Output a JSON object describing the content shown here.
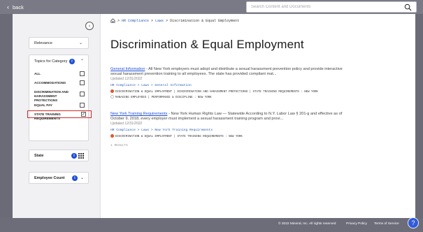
{
  "topbar": {
    "back_label": "back",
    "search_placeholder": "Search Content and Documents"
  },
  "sidebar": {
    "relevance_label": "Relevance",
    "topics_label": "Topics for Category",
    "topics": [
      {
        "label": "ALL",
        "checked": false
      },
      {
        "label": "ACCOMMODATIONS",
        "checked": false
      },
      {
        "label": "DISCRIMINATION AND HARASSMENT PROTECTIONS",
        "checked": false
      },
      {
        "label": "EQUAL PAY",
        "checked": false
      },
      {
        "label": "STATE TRAINING REQUIREMENTS",
        "checked": true
      }
    ],
    "state_label": "State",
    "employee_count_label": "Employee Count"
  },
  "breadcrumb": {
    "items": [
      "HR Compliance",
      "Laws",
      "Discrimination & Equal Employment"
    ]
  },
  "page_title": "Discrimination & Equal Employment",
  "results": [
    {
      "title": "General Information",
      "snippet": " - All New York employers must adopt and distribute a sexual harassment prevention policy and provide interactive sexual harassment prevention training to all employees. The state has provided compliant mat...",
      "date": "Updated 12/31/2022",
      "path": "HR Compliance > Laws > General Information",
      "tags_line1": "DISCRIMINATION & EQUAL EMPLOYMENT | DISCRIMINATION AND HARASSMENT PROTECTIONS | STATE TRAINING REQUIREMENTS : NEW YORK",
      "tags_line2": "MANAGING EMPLOYEES | PERFORMANCE & DISCIPLINE : NEW YORK"
    },
    {
      "title": "New York Training Requirements",
      "snippet": " - New York Human Rights Law — Statewide According to N.Y. Labor Law § 201-g and effective as of October 9, 2018, every employer must implement a sexual harassment training program and provi...",
      "date": "Updated 12/31/2022",
      "path": "HR Compliance > Laws > New York Training Requirements",
      "tags_line1": "DISCRIMINATION & EQUAL EMPLOYMENT | STATE TRAINING REQUIREMENTS : NEW YORK"
    }
  ],
  "more_results": "1 RESULTS",
  "footer": {
    "copyright": "© 2022 Mineral, Inc. All rights reserved",
    "privacy": "Privacy Policy",
    "terms": "Terms of Service"
  },
  "help_label": "?",
  "colors": {
    "link_blue": "#1e4fd6",
    "selected_outline": "#d62828",
    "tag_dot": "#e0552b"
  }
}
